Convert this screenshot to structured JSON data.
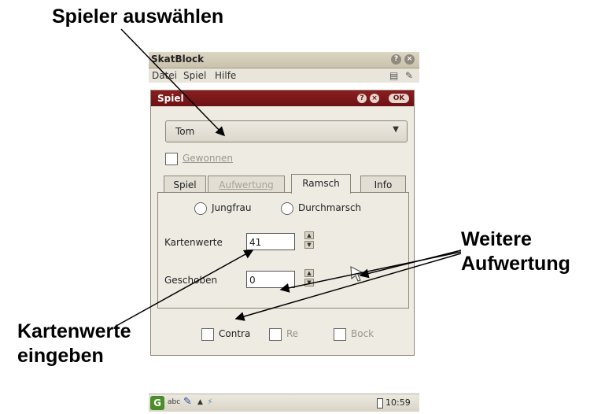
{
  "annotations": {
    "select_player": "Spieler auswählen",
    "more_upgrade_line1": "Weitere",
    "more_upgrade_line2": "Aufwertung",
    "enter_card_values_line1": "Kartenwerte",
    "enter_card_values_line2": "eingeben"
  },
  "app": {
    "title": "SkatBlock",
    "titlebar_buttons": [
      "?",
      "×"
    ],
    "menu": [
      "Datei",
      "Spiel",
      "Hilfe"
    ]
  },
  "dialog": {
    "title": "Spiel",
    "help_label": "?",
    "close_label": "×",
    "ok_label": "OK",
    "player_selected": "Tom",
    "won_label": "Gewonnen",
    "tabs": [
      {
        "label": "Spiel",
        "state": "normal"
      },
      {
        "label": "Aufwertung",
        "state": "disabled"
      },
      {
        "label": "Ramsch",
        "state": "active"
      },
      {
        "label": "Info",
        "state": "normal"
      }
    ],
    "radio_jungfrau": "Jungfrau",
    "radio_durchmarsch": "Durchmarsch",
    "card_values_label": "Kartenwerte",
    "card_values_value": "41",
    "pushed_label": "Geschoben",
    "pushed_value": "0",
    "contra_label": "Contra",
    "re_label": "Re",
    "bock_label": "Bock"
  },
  "taskbar": {
    "keyboard_label": "abc",
    "time": "10:59"
  }
}
